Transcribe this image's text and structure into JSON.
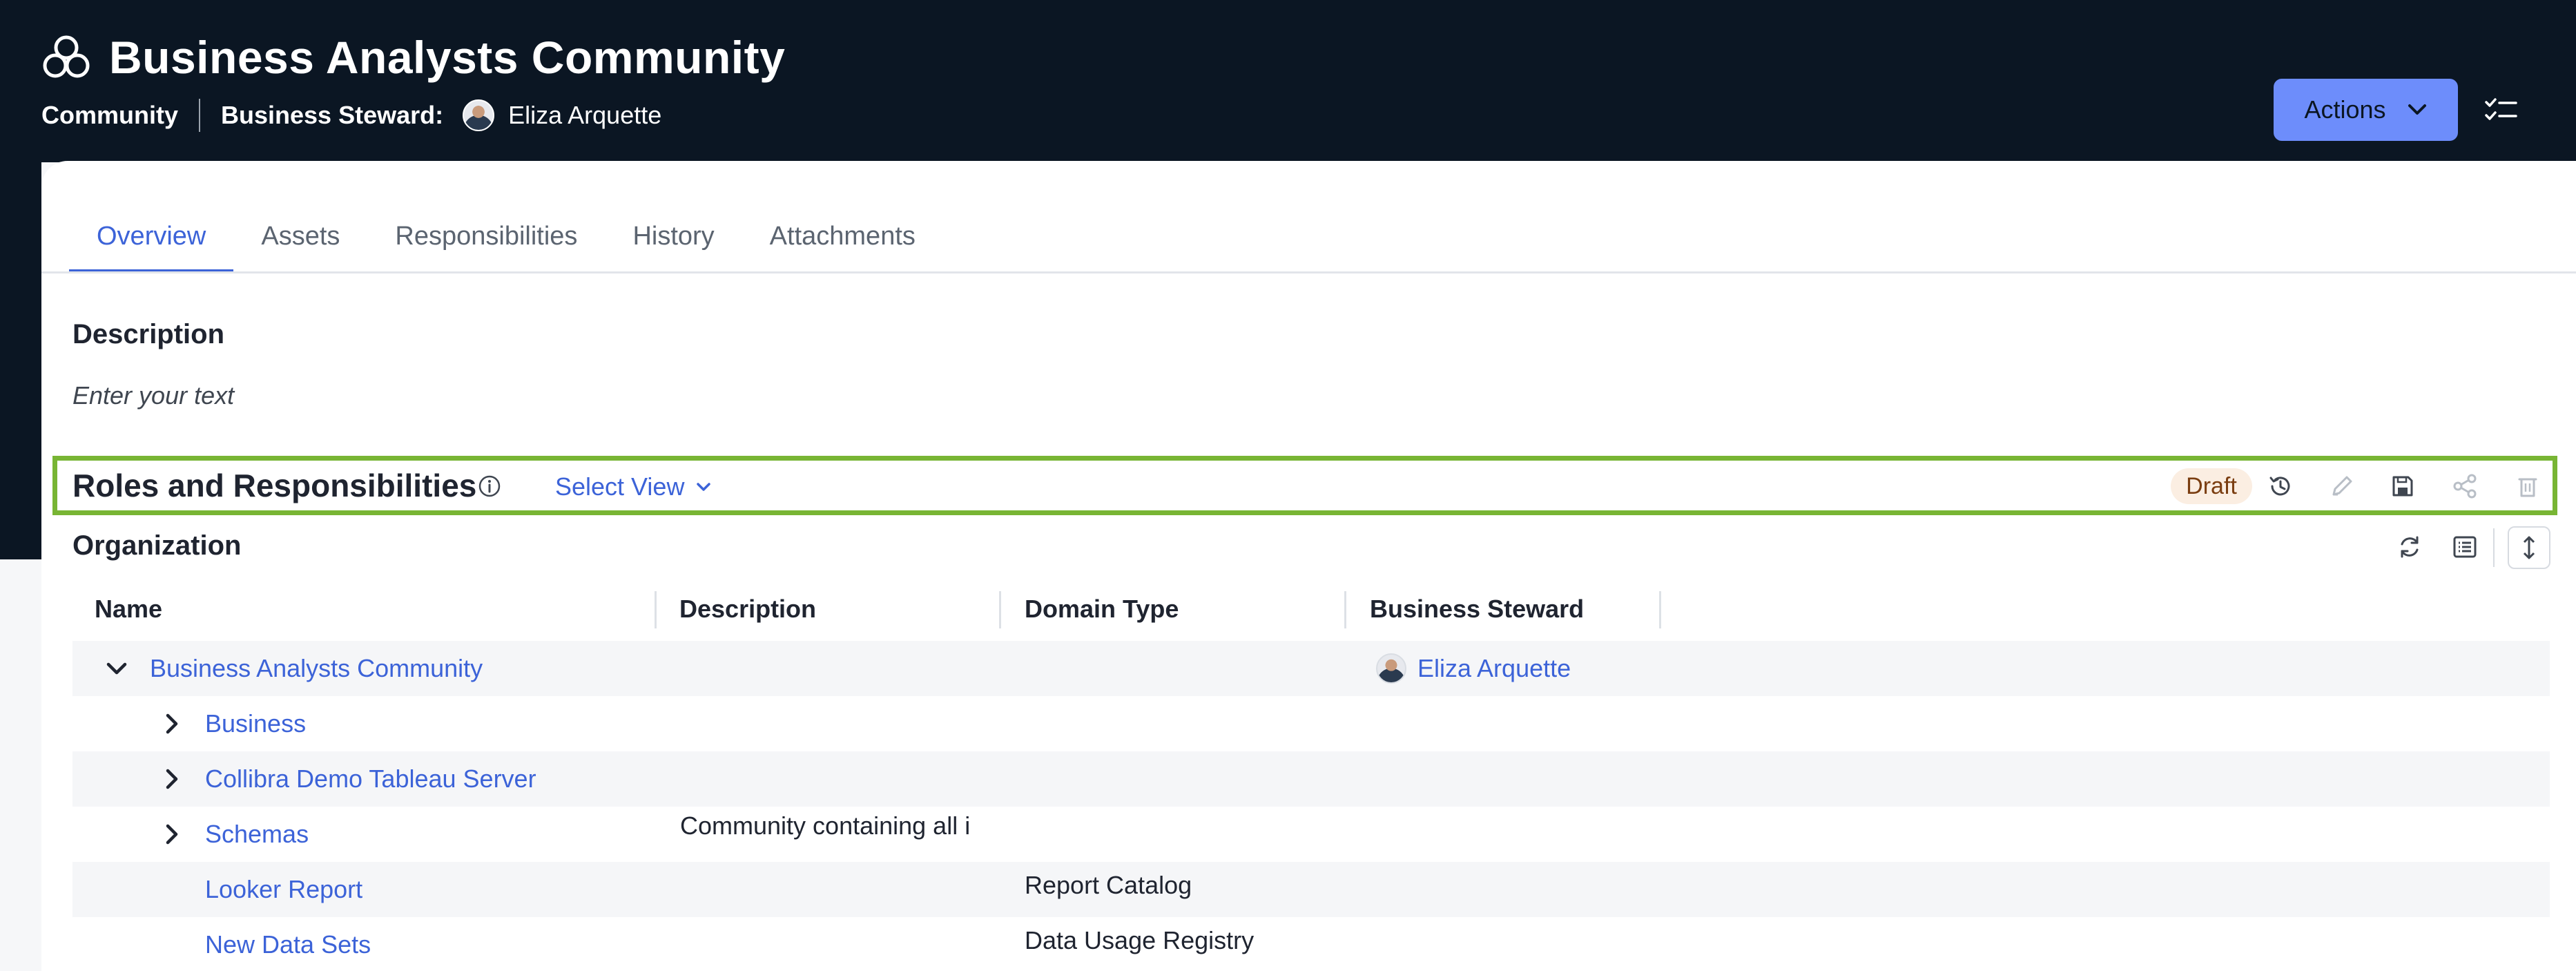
{
  "header": {
    "title": "Business Analysts Community",
    "asset_type": "Community",
    "role_label": "Business Steward:",
    "role_person": "Eliza Arquette",
    "actions_label": "Actions"
  },
  "tabs": [
    {
      "label": "Overview",
      "active": true
    },
    {
      "label": "Assets",
      "active": false
    },
    {
      "label": "Responsibilities",
      "active": false
    },
    {
      "label": "History",
      "active": false
    },
    {
      "label": "Attachments",
      "active": false
    }
  ],
  "description": {
    "title": "Description",
    "placeholder": "Enter your text"
  },
  "roles": {
    "title": "Roles and Responsibilities",
    "select_view_label": "Select View",
    "status_badge": "Draft",
    "highlight_color": "#78b534"
  },
  "organization": {
    "title": "Organization",
    "columns": [
      "Name",
      "Description",
      "Domain Type",
      "Business Steward"
    ],
    "rows": [
      {
        "name": "Business Analysts Community",
        "description": "",
        "domain_type": "",
        "steward": "Eliza Arquette",
        "expanded": true
      },
      {
        "name": "Business",
        "description": "",
        "domain_type": "",
        "steward": "",
        "expanded": false
      },
      {
        "name": "Collibra Demo Tableau Server",
        "description": "",
        "domain_type": "",
        "steward": "",
        "expanded": false
      },
      {
        "name": "Schemas",
        "description": "Community containing all i",
        "domain_type": "",
        "steward": "",
        "expanded": false
      },
      {
        "name": "Looker Report",
        "description": "",
        "domain_type": "Report Catalog",
        "steward": ""
      },
      {
        "name": "New Data Sets",
        "description": "",
        "domain_type": "Data Usage Registry",
        "steward": ""
      }
    ]
  },
  "colors": {
    "header_bg": "#0b1623",
    "accent": "#3c63d8",
    "actions_button": "#6d8dfb"
  }
}
